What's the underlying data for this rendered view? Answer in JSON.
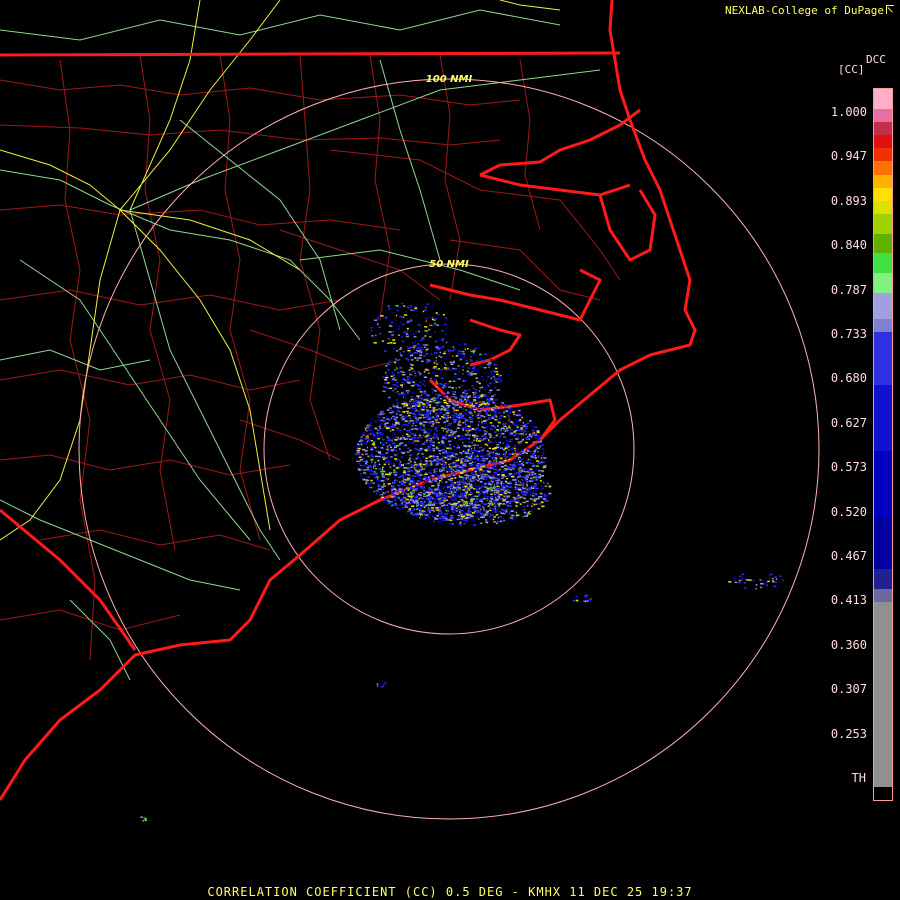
{
  "credit": "NEXLAB-College of DuPage",
  "credit_icon": "external-link-icon",
  "footer_title": "CORRELATION COEFFICIENT (CC) 0.5 DEG - KMHX 11 DEC 25 19:37",
  "legend": {
    "unit": "[CC]",
    "code": "DCC",
    "ticks": [
      "1.000",
      "0.947",
      "0.893",
      "0.840",
      "0.787",
      "0.733",
      "0.680",
      "0.627",
      "0.573",
      "0.520",
      "0.467",
      "0.413",
      "0.360",
      "0.307",
      "0.253",
      "TH"
    ],
    "bands": [
      {
        "color": "#ffb0c8"
      },
      {
        "color": "#e870a0"
      },
      {
        "color": "#c0304a"
      },
      {
        "color": "#e01010"
      },
      {
        "color": "#f03000"
      },
      {
        "color": "#ff7000"
      },
      {
        "color": "#ffb000"
      },
      {
        "color": "#ffe000"
      },
      {
        "color": "#e0e000"
      },
      {
        "color": "#a0d000"
      },
      {
        "color": "#60b000"
      },
      {
        "color": "#40e040"
      },
      {
        "color": "#80f080"
      },
      {
        "color": "#a0a0e0"
      },
      {
        "color": "#8080d0"
      },
      {
        "color": "#3030e0"
      },
      {
        "color": "#1010d0"
      },
      {
        "color": "#0000c0"
      },
      {
        "color": "#0000a0"
      },
      {
        "color": "#202090"
      },
      {
        "color": "#6a6aa0"
      },
      {
        "color": "#909090"
      },
      {
        "color": "#000000"
      }
    ]
  },
  "range_rings": [
    {
      "label": "100 NMI"
    },
    {
      "label": "50 NMI"
    }
  ],
  "colors": {
    "state_border": "#ff1a1a",
    "county_border": "#b01818",
    "highway_yellow": "#f0f040",
    "highway_green": "#90d890",
    "ring": "#ffb0b0",
    "ring_label": "#ffff66"
  }
}
